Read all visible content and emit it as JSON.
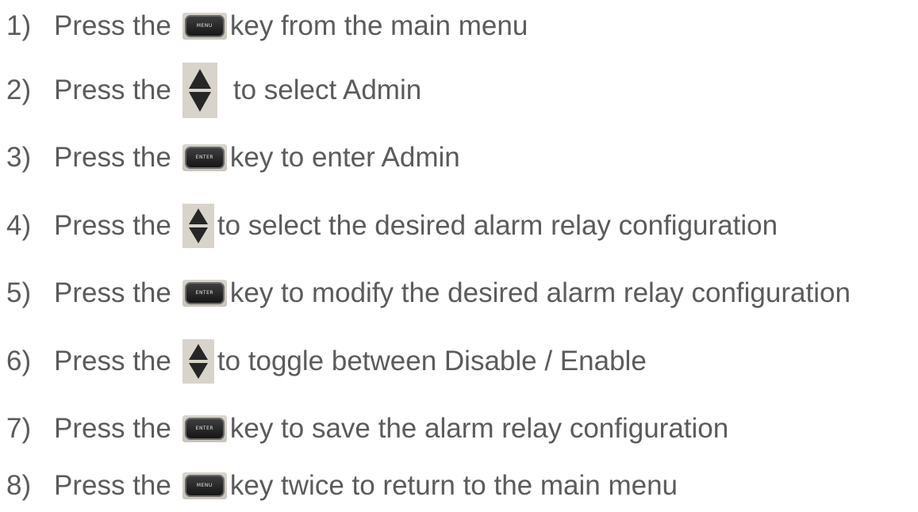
{
  "steps": [
    {
      "num": "1)",
      "pre": "Press the",
      "icon": "menu-key-icon",
      "key_label": "MENU",
      "post": "key from the main menu"
    },
    {
      "num": "2)",
      "pre": "Press the",
      "icon": "up-down-arrow-icon",
      "post": "to select Admin"
    },
    {
      "num": "3)",
      "pre": "Press the",
      "icon": "enter-key-icon",
      "key_label": "ENTER",
      "post": "key to enter Admin"
    },
    {
      "num": "4)",
      "pre": "Press the",
      "icon": "up-down-arrow-icon",
      "post": "to select the desired alarm relay configuration"
    },
    {
      "num": "5)",
      "pre": "Press the",
      "icon": "enter-key-icon",
      "key_label": "ENTER",
      "post": "key to modify the desired alarm relay configuration"
    },
    {
      "num": "6)",
      "pre": "Press the",
      "icon": "up-down-arrow-icon",
      "post": "to toggle between Disable / Enable"
    },
    {
      "num": "7)",
      "pre": "Press the",
      "icon": "enter-key-icon",
      "key_label": "ENTER",
      "post": "key to save the alarm relay configuration"
    },
    {
      "num": "8)",
      "pre": "Press the",
      "icon": "menu-key-icon",
      "key_label": "MENU",
      "post": "key twice to return to the main menu"
    }
  ],
  "colors": {
    "text": "#5b5b5b",
    "key_body": "#1e1e1e",
    "icon_background": "#d9d4cb"
  }
}
